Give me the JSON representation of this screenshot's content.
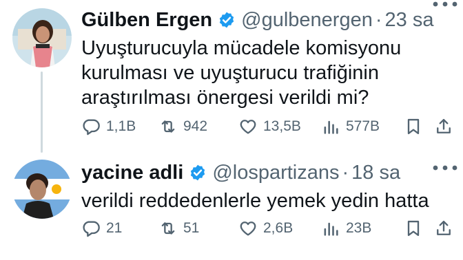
{
  "tweets": [
    {
      "name": "Gülben Ergen",
      "handle": "@gulbenergen",
      "separator": "·",
      "time": "23 sa",
      "text_lines": [
        "Uyuşturucuyla mücadele komisyonu",
        "kurulması ve uyuşturucu trafiğinin",
        "araştırılması önergesi verildi mi?"
      ],
      "replies": "1,1B",
      "retweets": "942",
      "likes": "13,5B",
      "views": "577B"
    },
    {
      "name": "yacine adli",
      "handle": "@lospartizans",
      "separator": "·",
      "time": "18 sa",
      "text_lines": [
        "verildi reddedenlerle yemek yedin hatta"
      ],
      "replies": "21",
      "retweets": "51",
      "likes": "2,6B",
      "views": "23B"
    }
  ],
  "colors": {
    "verified": "#1d9bf0",
    "muted": "#536471",
    "text": "#0f1419"
  },
  "icons": [
    "reply-icon",
    "retweet-icon",
    "like-icon",
    "views-icon",
    "bookmark-icon",
    "share-icon",
    "more-icon",
    "verified-badge-icon"
  ]
}
